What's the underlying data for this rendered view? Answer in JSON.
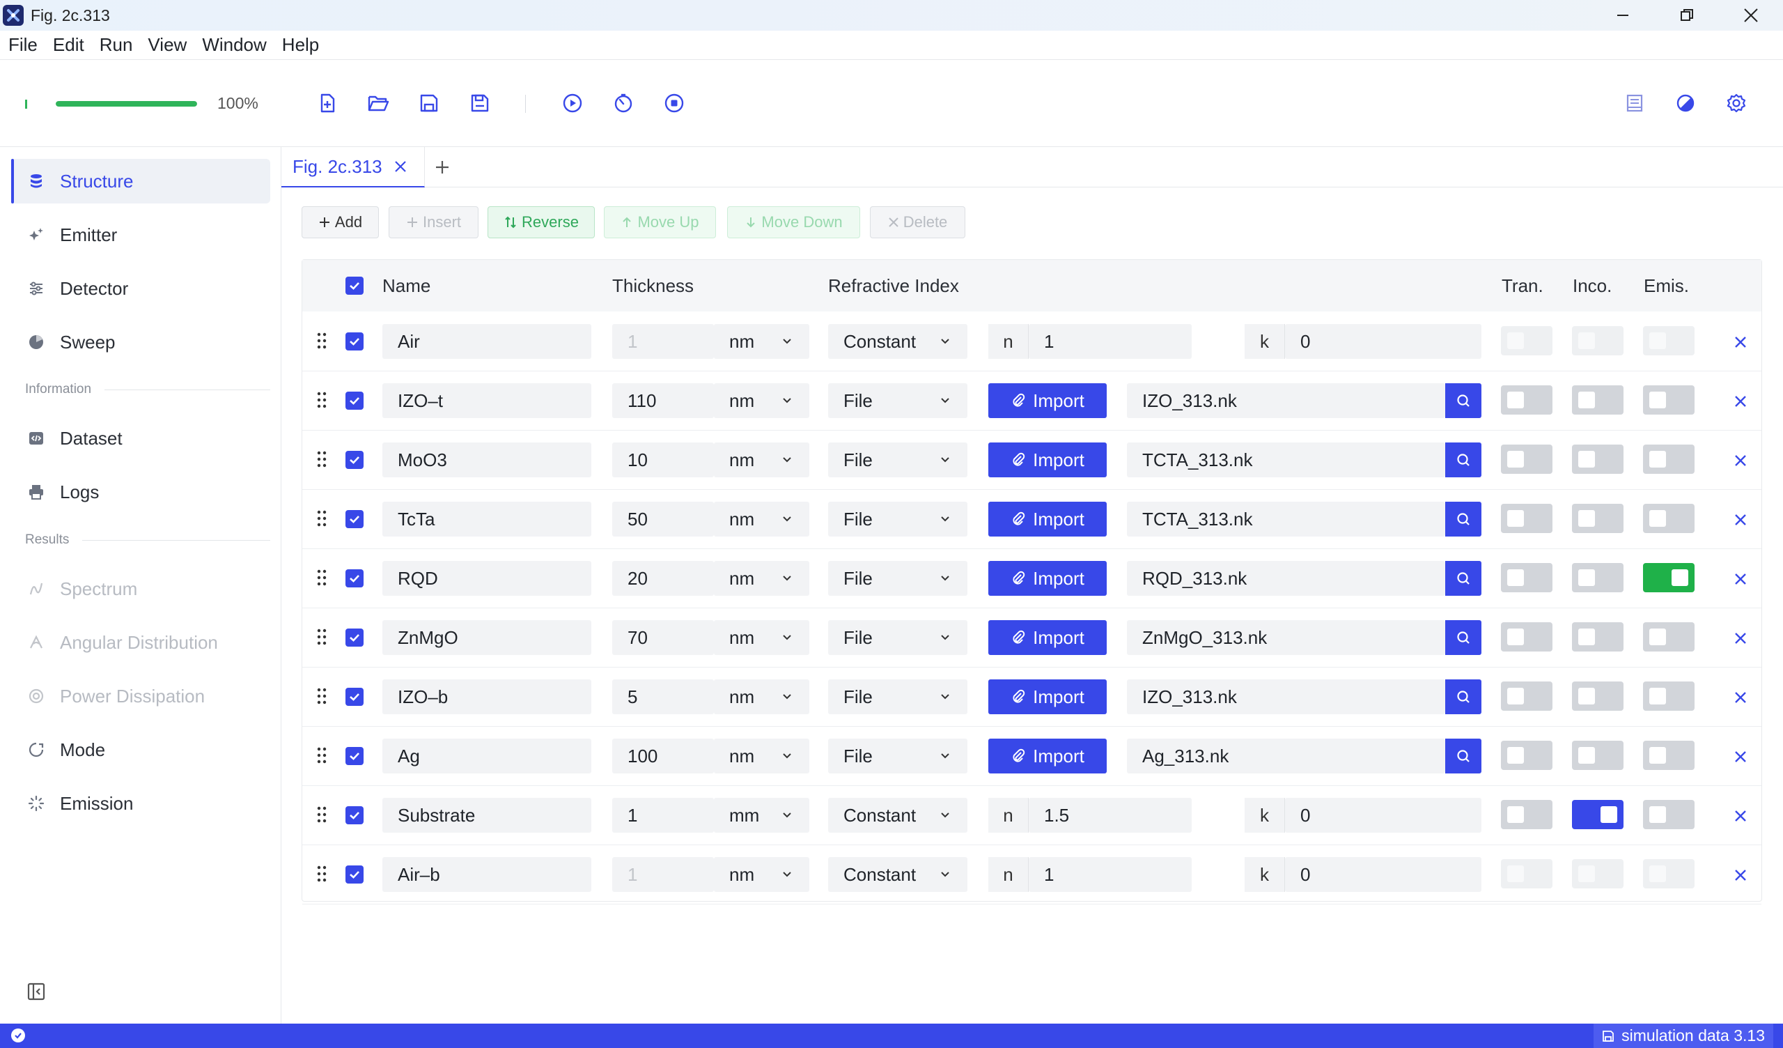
{
  "window": {
    "title": "Fig. 2c.313"
  },
  "menu": [
    "File",
    "Edit",
    "Run",
    "View",
    "Window",
    "Help"
  ],
  "toolbar": {
    "progress_label": "100%",
    "progress_value": 1.0,
    "icons": [
      "new-file-icon",
      "open-folder-icon",
      "save-icon",
      "save-as-icon",
      "run-icon",
      "timer-icon",
      "stop-icon",
      "book-icon",
      "theme-icon",
      "settings-icon"
    ]
  },
  "sidebar": {
    "items": [
      {
        "label": "Structure",
        "icon": "database-icon",
        "active": true
      },
      {
        "label": "Emitter",
        "icon": "sparkle-icon"
      },
      {
        "label": "Detector",
        "icon": "sliders-icon"
      },
      {
        "label": "Sweep",
        "icon": "sweep-icon"
      }
    ],
    "information_label": "Information",
    "information_items": [
      {
        "label": "Dataset",
        "icon": "code-icon"
      },
      {
        "label": "Logs",
        "icon": "printer-icon"
      }
    ],
    "results_label": "Results",
    "results_items": [
      {
        "label": "Spectrum",
        "icon": "spectrum-icon",
        "disabled": true
      },
      {
        "label": "Angular Distribution",
        "icon": "angular-icon",
        "disabled": true
      },
      {
        "label": "Power Dissipation",
        "icon": "power-icon",
        "disabled": true
      },
      {
        "label": "Mode",
        "icon": "mode-icon"
      },
      {
        "label": "Emission",
        "icon": "emission-icon"
      }
    ]
  },
  "tabs": {
    "active_label": "Fig. 2c.313"
  },
  "actions": {
    "add": "Add",
    "insert": "Insert",
    "reverse": "Reverse",
    "move_up": "Move Up",
    "move_down": "Move Down",
    "delete": "Delete"
  },
  "table": {
    "headers": {
      "name": "Name",
      "thickness": "Thickness",
      "refractive_index": "Refractive Index",
      "tran": "Tran.",
      "inco": "Inco.",
      "emis": "Emis."
    },
    "import_label": "Import",
    "n_label": "n",
    "k_label": "k",
    "rows": [
      {
        "name": "Air",
        "thickness": "1",
        "unit": "nm",
        "type": "Constant",
        "n": "1",
        "k": "0",
        "thickness_dim": true,
        "tran": false,
        "inco": false,
        "emis": false,
        "toggles_disabled": true
      },
      {
        "name": "IZO–t",
        "thickness": "110",
        "unit": "nm",
        "type": "File",
        "file": "IZO_313.nk",
        "tran": false,
        "inco": false,
        "emis": false
      },
      {
        "name": "MoO3",
        "thickness": "10",
        "unit": "nm",
        "type": "File",
        "file": "TCTA_313.nk",
        "tran": false,
        "inco": false,
        "emis": false
      },
      {
        "name": "TcTa",
        "thickness": "50",
        "unit": "nm",
        "type": "File",
        "file": "TCTA_313.nk",
        "tran": false,
        "inco": false,
        "emis": false
      },
      {
        "name": "RQD",
        "thickness": "20",
        "unit": "nm",
        "type": "File",
        "file": "RQD_313.nk",
        "tran": false,
        "inco": false,
        "emis": true
      },
      {
        "name": "ZnMgO",
        "thickness": "70",
        "unit": "nm",
        "type": "File",
        "file": "ZnMgO_313.nk",
        "tran": false,
        "inco": false,
        "emis": false
      },
      {
        "name": "IZO–b",
        "thickness": "5",
        "unit": "nm",
        "type": "File",
        "file": "IZO_313.nk",
        "tran": false,
        "inco": false,
        "emis": false
      },
      {
        "name": "Ag",
        "thickness": "100",
        "unit": "nm",
        "type": "File",
        "file": "Ag_313.nk",
        "tran": false,
        "inco": false,
        "emis": false
      },
      {
        "name": "Substrate",
        "thickness": "1",
        "unit": "mm",
        "type": "Constant",
        "n": "1.5",
        "k": "0",
        "tran": false,
        "inco": true,
        "emis": false
      },
      {
        "name": "Air–b",
        "thickness": "1",
        "unit": "nm",
        "type": "Constant",
        "n": "1",
        "k": "0",
        "thickness_dim": true,
        "tran": false,
        "inco": false,
        "emis": false,
        "toggles_disabled": true
      }
    ]
  },
  "status": {
    "right_label": "simulation data 3.13"
  },
  "colors": {
    "accent": "#3848e8",
    "green": "#2fb45a",
    "emis_on": "#1fb149"
  }
}
